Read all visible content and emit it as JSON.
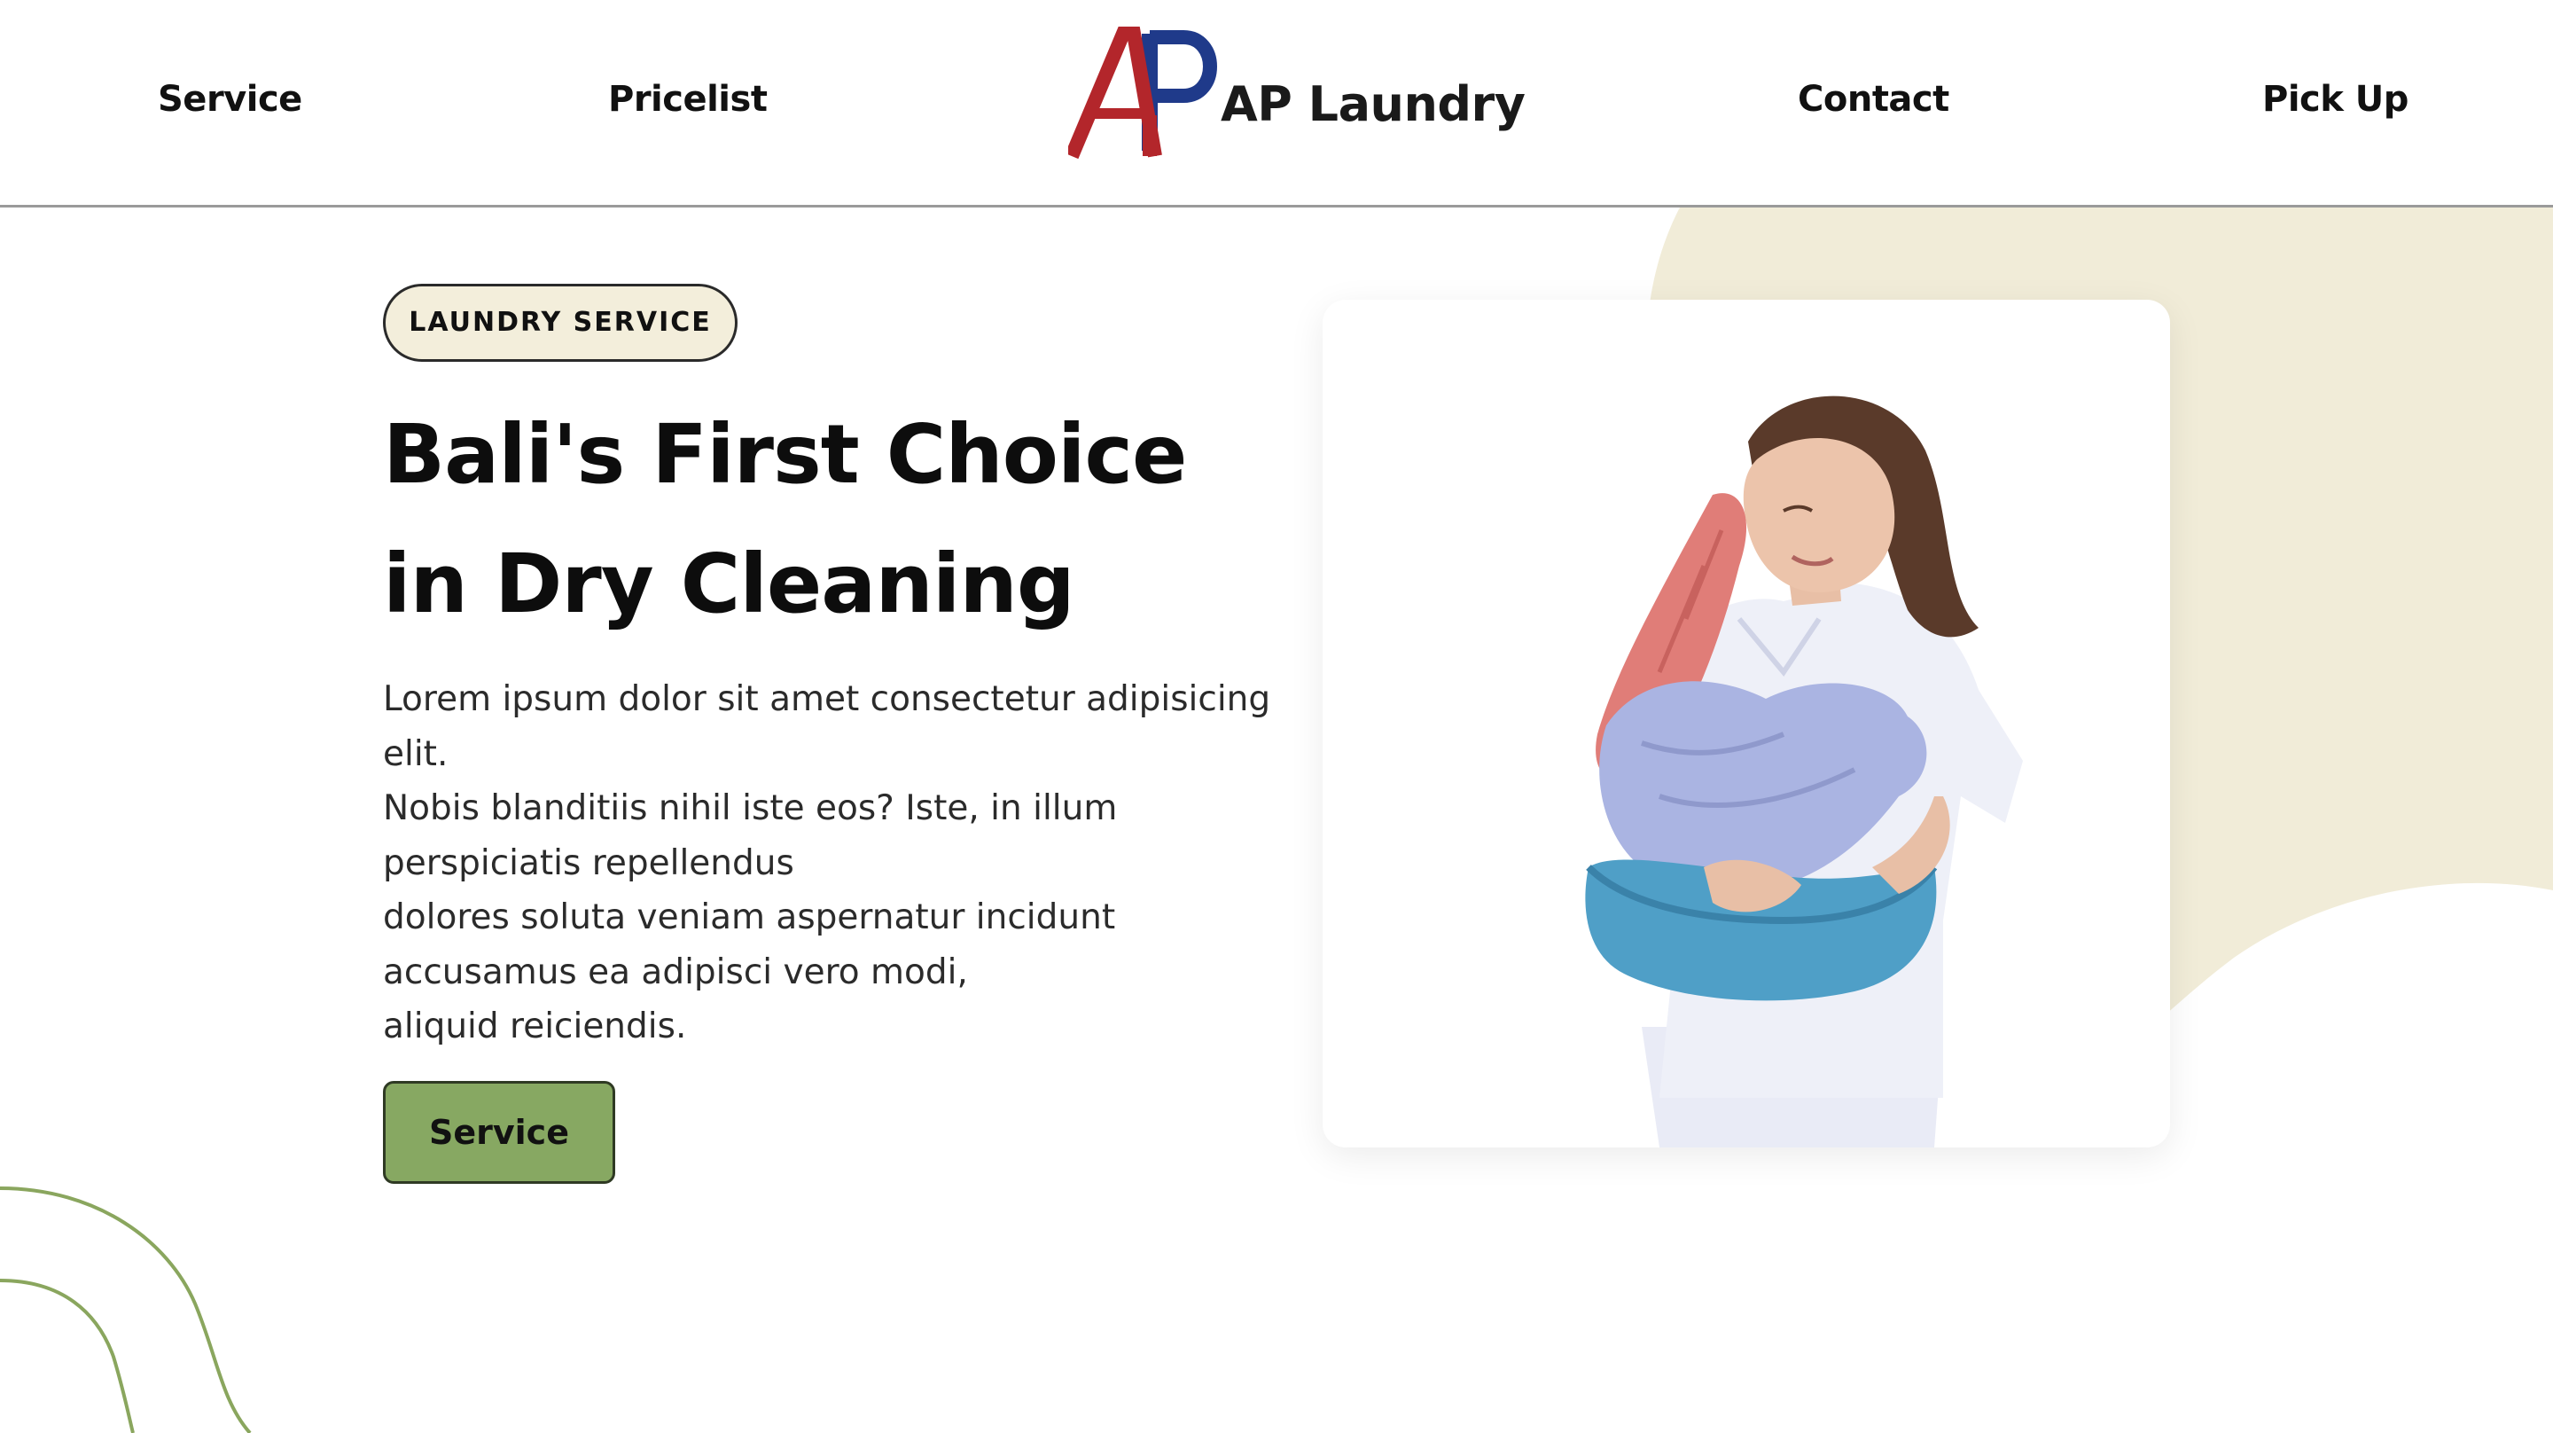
{
  "brand": {
    "logo_name": "AP Laundry",
    "logo_monogram": "AP",
    "colors": {
      "red": "#b3262b",
      "navy": "#1f3a8a"
    }
  },
  "nav": {
    "items": [
      {
        "label": "Service"
      },
      {
        "label": "Pricelist"
      },
      {
        "label": "Contact"
      },
      {
        "label": "Pick Up"
      }
    ]
  },
  "hero": {
    "badge": "LAUNDRY SERVICE",
    "title_lines": [
      "Bali's First Choice",
      "in Dry Cleaning"
    ],
    "text_lines": [
      "Lorem ipsum dolor sit amet consectetur adipisicing",
      "elit.",
      "Nobis blanditiis nihil iste eos? Iste, in illum",
      "perspiciatis repellendus",
      "dolores soluta veniam aspernatur incidunt",
      "accusamus ea adipisci vero modi,",
      "aliquid reiciendis."
    ],
    "cta_label": "Service",
    "image_icon": "woman-holding-laundry-basket"
  },
  "colors": {
    "accent_green": "#87a862",
    "badge_bg": "#f3eedb",
    "blob": "#f1ecd8",
    "curve": "#8aa65e"
  }
}
